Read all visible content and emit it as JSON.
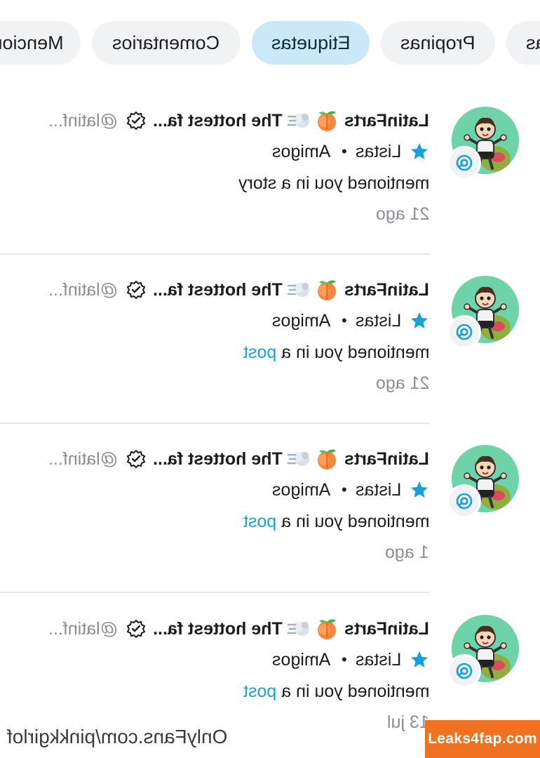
{
  "tabs": [
    {
      "label": "Todas",
      "active": false
    },
    {
      "label": "Propinas",
      "active": false
    },
    {
      "label": "Etiquetas",
      "active": true
    },
    {
      "label": "Comentarios",
      "active": false
    },
    {
      "label": "Menciones",
      "active": false
    }
  ],
  "notifications": [
    {
      "name": "LatinFarts",
      "description": "The hottest fa...",
      "handle": "@latinf...",
      "list_label": "Listas",
      "list_separator": "•",
      "list_name": "Amigos",
      "message_prefix": "mentioned you in a",
      "message_link": "",
      "message_plain": "mentioned you in a story",
      "time": "21 ago"
    },
    {
      "name": "LatinFarts",
      "description": "The hottest fa...",
      "handle": "@latinf...",
      "list_label": "Listas",
      "list_separator": "•",
      "list_name": "Amigos",
      "message_prefix": "mentioned you in a",
      "message_link": "post",
      "time": "21 ago"
    },
    {
      "name": "LatinFarts",
      "description": "The hottest fa...",
      "handle": "@latinf...",
      "list_label": "Listas",
      "list_separator": "•",
      "list_name": "Amigos",
      "message_prefix": "mentioned you in a",
      "message_link": "post",
      "time": "1 ago"
    },
    {
      "name": "LatinFarts",
      "description": "The hottest fa...",
      "handle": "@latinf...",
      "list_label": "Listas",
      "list_separator": "•",
      "list_name": "Amigos",
      "message_prefix": "mentioned you in a",
      "message_link": "post",
      "time": "13 jul"
    }
  ],
  "footer": {
    "watermark": "OnlyFans.com/pinkkgirlof",
    "brand": "Leaks4fap.com"
  },
  "icons": {
    "emoji_1": "peach-emoji",
    "emoji_2": "dash-emoji",
    "verified": "verified-badge-icon",
    "badge": "mention-at-icon",
    "list": "star-icon"
  },
  "colors": {
    "accent": "#1aa0d9",
    "active_tab_bg": "#cbe8f9",
    "tab_bg": "#f1f2f4",
    "avatar_bg": "#6ed3a8",
    "muted_text": "#8a8d93",
    "brand_bg": "#f0711f"
  }
}
